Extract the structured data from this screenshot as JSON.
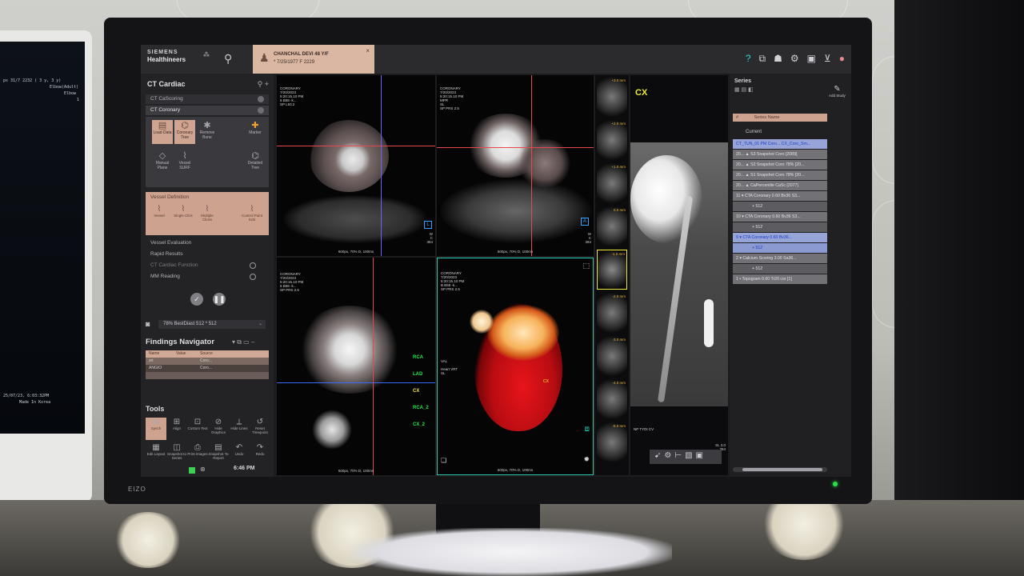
{
  "left_monitor": {
    "lines": [
      "ps 31/7 2232 ( 3 y, 3 y)",
      "Elbow(Adult)",
      "Elbow",
      "1",
      "25/07/23, 6:03:32PM",
      "Made In Korea"
    ]
  },
  "brand": {
    "monitor_logo": "EIZO"
  },
  "topbar": {
    "logo_line1": "SIEMENS",
    "logo_line2": "Healthineers",
    "patient": {
      "name": "CHANCHAL DEVI 48 Y/F",
      "dob": "* 7/25/1977 F 2229",
      "close": "×"
    }
  },
  "left_panel": {
    "title": "CT Cardiac",
    "workflow_steps": [
      {
        "label": "CT CaScoring"
      },
      {
        "label": "CT Coronary"
      }
    ],
    "workflow_buttons": [
      {
        "label": "Load Data",
        "icon": "load-icon"
      },
      {
        "label": "Coronary Tree",
        "icon": "tree-icon"
      },
      {
        "label": "Remove Bone",
        "icon": "bone-icon"
      },
      {
        "label": "Marker",
        "icon": "marker-icon"
      },
      {
        "label": "Manual Plane",
        "icon": "plane-icon"
      },
      {
        "label": "Vessel SURF",
        "icon": "surf-icon"
      },
      {
        "label": "Detailed Tree",
        "icon": "detail-tree-icon"
      }
    ],
    "vessel_definition": {
      "title": "Vessel Definition",
      "buttons": [
        "Vessel",
        "Single Click",
        "Multiple Clicks",
        "Control Point Edit"
      ]
    },
    "steps_below": [
      {
        "label": "Vessel Evaluation"
      },
      {
        "label": "Rapid Results"
      },
      {
        "label": "CT Cardiac Function"
      },
      {
        "label": "MM Reading"
      }
    ],
    "preset": "78%  BestDiast 512 * 512",
    "findings_title": "Findings Navigator",
    "findings_columns": [
      "Name",
      "Value",
      "Source"
    ],
    "findings_rows": [
      {
        "name": "srt",
        "value": "",
        "source": "Coro..."
      },
      {
        "name": "ANGIO",
        "value": "",
        "source": "Coro..."
      }
    ],
    "tools_title": "Tools",
    "tools": [
      {
        "label": "Synch",
        "icon": "synch-icon"
      },
      {
        "label": "Align",
        "icon": "align-icon"
      },
      {
        "label": "Custom Text",
        "icon": "text-icon"
      },
      {
        "label": "Hide Graphics",
        "icon": "hide-icon"
      },
      {
        "label": "Hide Lines",
        "icon": "lines-icon"
      },
      {
        "label": "Reset Timepoint",
        "icon": "reset-icon"
      },
      {
        "label": "Edit Layout",
        "icon": "layout-icon"
      },
      {
        "label": "Snapshot to Series",
        "icon": "snapshot-icon"
      },
      {
        "label": "Print Images",
        "icon": "print-icon"
      },
      {
        "label": "Snapshot To Report",
        "icon": "report-icon"
      },
      {
        "label": "Undo",
        "icon": "undo-icon"
      },
      {
        "label": "Redo",
        "icon": "redo-icon"
      }
    ],
    "clock": "6:46 PM"
  },
  "viewports": {
    "top_left": {
      "header": "CORONARY\n7/20/2023\n5:20:15.10 PM\n5 B58 -k...\nSP L93.2",
      "foot": "600px, 70% D, 100ms",
      "side": "W\nC\n384",
      "orient": "L"
    },
    "top_mid": {
      "header": "CORONARY\n7/20/2023\n5:20:15.10 PM\nMPR\nSL\nSP PRS 2.5",
      "foot": "600px, 70% D, 100ms",
      "side": "W\nC\n384",
      "orient": "A"
    },
    "bottom_left": {
      "header": "CORONARY\n7/20/2023\n5:20:15.10 PM\n5 B58 -k...\nSP PRS 2.5",
      "foot": "600px, 70% D, 100ms",
      "vessels": [
        "RCA",
        "LAD",
        "CX",
        "RCA_2",
        "CX_2"
      ]
    },
    "bottom_mid": {
      "header": "CORONARY\n7/20/2023\n5:20:15.10 PM\nB B58 -k...\nSP PRS 2.5",
      "mid": "VAL\n\nHeart VRT\nSL",
      "foot": "600px, 70% D, 100ms",
      "cx_label": "CX"
    },
    "strip_labels": [
      "+3.0 mm",
      "+2.0 mm",
      "+1.0 mm",
      "0.0 mm",
      "-1.0 mm",
      "-2.0 mm",
      "-3.0 mm",
      "-4.0 mm",
      "-5.0 mm"
    ],
    "curved": {
      "vessel": "CX",
      "foot_left": "NP TYDI CV",
      "foot_right": "SL 3.0\n384"
    }
  },
  "series_panel": {
    "title": "Series",
    "add_study": "Add Study",
    "column": "Series Name",
    "current_label": "Current",
    "rows": [
      {
        "num": "",
        "name": "CT_TUN_01 PM Coro... CX_Coro_Sm...",
        "style": "blue"
      },
      {
        "num": "20...",
        "name": "S3 Snapshot Coro [2089]",
        "style": ""
      },
      {
        "num": "20...",
        "name": "S2 Snapshot Coro 78% [20...",
        "style": ""
      },
      {
        "num": "20...",
        "name": "S1 Snapshot Coro 78% [20...",
        "style": ""
      },
      {
        "num": "20...",
        "name": "CaPercentile CaSc [2077]",
        "style": ""
      },
      {
        "num": "11",
        "name": "CTA Coronary 0.60 Bv36 S3...",
        "style": ""
      },
      {
        "num": "",
        "name": "512",
        "style": "sub"
      },
      {
        "num": "10",
        "name": "CTA Coronary 0.60 Bv36 S3...",
        "style": ""
      },
      {
        "num": "",
        "name": "512",
        "style": "sub"
      },
      {
        "num": "9",
        "name": "CTA Coronary 0.60 Bv36...",
        "style": "blue"
      },
      {
        "num": "",
        "name": "512",
        "style": "blue sub"
      },
      {
        "num": "2",
        "name": "Calcium Scoring 3.00 Sa36...",
        "style": ""
      },
      {
        "num": "",
        "name": "512",
        "style": "sub"
      },
      {
        "num": "1",
        "name": "Topogram 0.60 Tr20 cor [1]",
        "style": ""
      }
    ]
  }
}
